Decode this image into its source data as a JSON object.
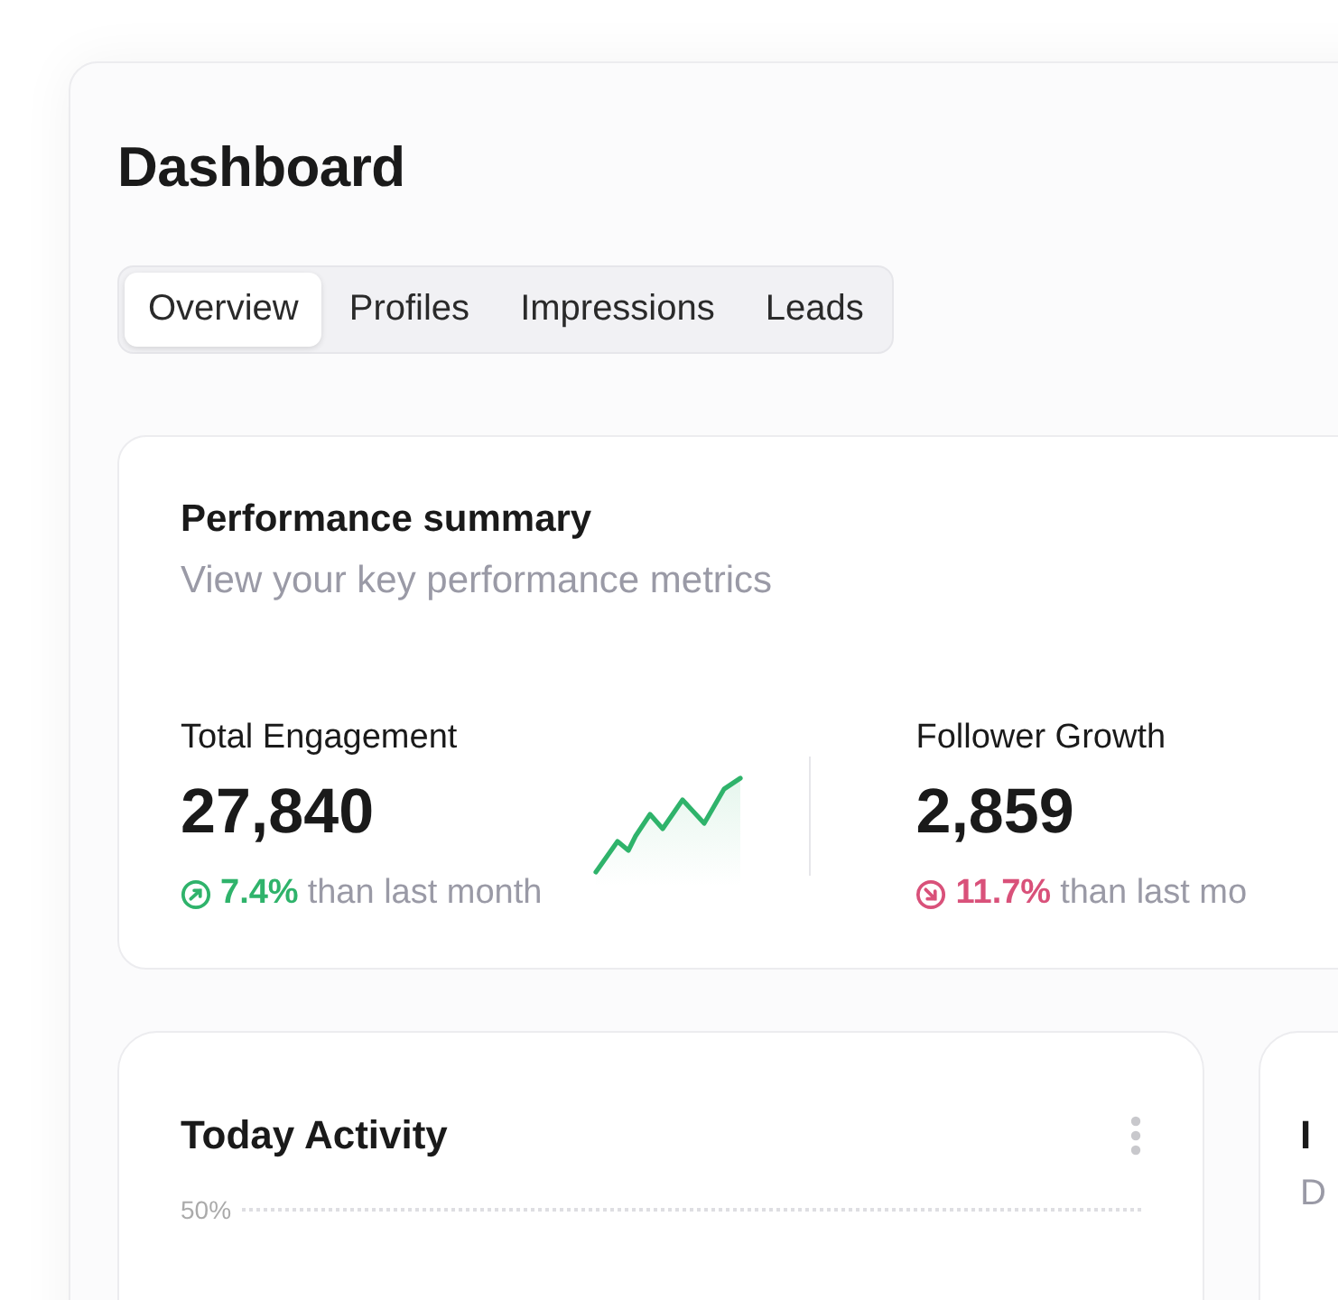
{
  "title": "Dashboard",
  "tabs": [
    {
      "label": "Overview",
      "selected": true
    },
    {
      "label": "Profiles",
      "selected": false
    },
    {
      "label": "Impressions",
      "selected": false
    },
    {
      "label": "Leads",
      "selected": false
    }
  ],
  "summary": {
    "title": "Performance summary",
    "subtitle": "View your key performance metrics",
    "metrics": [
      {
        "label": "Total Engagement",
        "value": "27,840",
        "kind": "up",
        "change": "7.4%",
        "note": "than last month"
      },
      {
        "label": "Follower Growth",
        "value": "2,859",
        "kind": "down",
        "change": "11.7%",
        "note": "than last mo"
      }
    ]
  },
  "activity": {
    "title": "Today Activity",
    "tick": "50%"
  },
  "side_card": {
    "title": "I",
    "subtitle": "D"
  }
}
